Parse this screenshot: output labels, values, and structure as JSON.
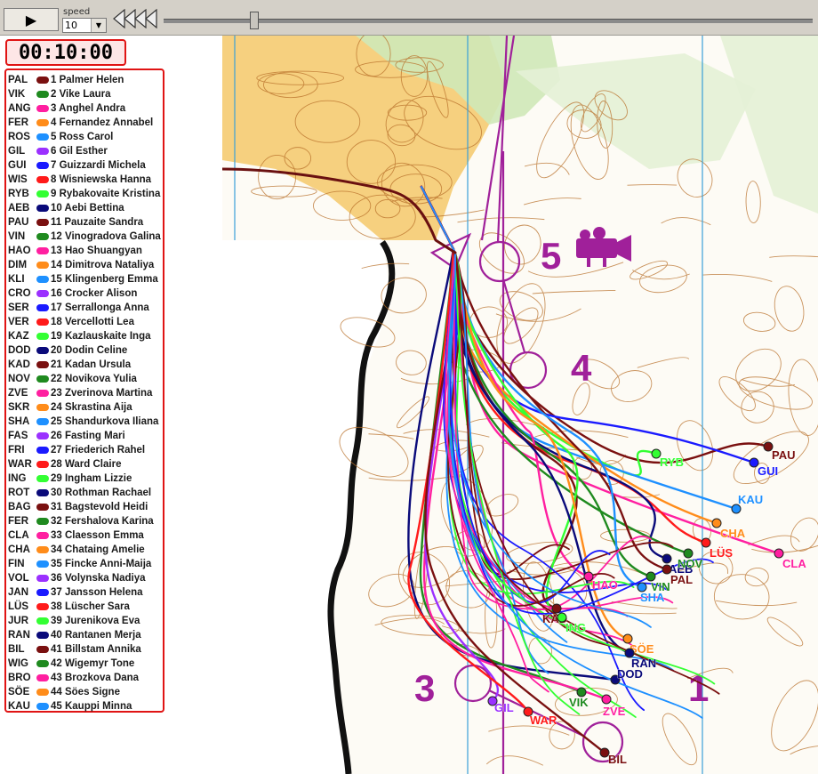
{
  "toolbar": {
    "play_icon": "play-icon",
    "play_symbol": "▶",
    "speed_label": "speed",
    "speed_value": "10",
    "rewind_icon": "rewind-icon",
    "timeline_position": 0.14
  },
  "clock": {
    "time": "00:10:00"
  },
  "runners": [
    {
      "code": "PAL",
      "name": "1 Palmer Helen",
      "color": "#7a1010"
    },
    {
      "code": "VIK",
      "name": "2 Vike Laura",
      "color": "#1f8a1f"
    },
    {
      "code": "ANG",
      "name": "3 Anghel Andra",
      "color": "#ff1fa0"
    },
    {
      "code": "FER",
      "name": "4 Fernandez Annabel",
      "color": "#ff8c1a"
    },
    {
      "code": "ROS",
      "name": "5 Ross Carol",
      "color": "#1e90ff"
    },
    {
      "code": "GIL",
      "name": "6 Gil Esther",
      "color": "#9b30ff"
    },
    {
      "code": "GUI",
      "name": "7 Guizzardi Michela",
      "color": "#1a1aff"
    },
    {
      "code": "WIS",
      "name": "8 Wisniewska Hanna",
      "color": "#ff1a1a"
    },
    {
      "code": "RYB",
      "name": "9 Rybakovaite Kristina",
      "color": "#33ff33"
    },
    {
      "code": "AEB",
      "name": "10 Aebi Bettina",
      "color": "#0a0a7a"
    },
    {
      "code": "PAU",
      "name": "11 Pauzaite Sandra",
      "color": "#7a1010"
    },
    {
      "code": "VIN",
      "name": "12 Vinogradova Galina",
      "color": "#1f8a1f"
    },
    {
      "code": "HAO",
      "name": "13 Hao Shuangyan",
      "color": "#ff1fa0"
    },
    {
      "code": "DIM",
      "name": "14 Dimitrova Nataliya",
      "color": "#ff8c1a"
    },
    {
      "code": "KLI",
      "name": "15 Klingenberg Emma",
      "color": "#1e90ff"
    },
    {
      "code": "CRO",
      "name": "16 Crocker Alison",
      "color": "#9b30ff"
    },
    {
      "code": "SER",
      "name": "17 Serrallonga Anna",
      "color": "#1a1aff"
    },
    {
      "code": "VER",
      "name": "18 Vercellotti Lea",
      "color": "#ff1a1a"
    },
    {
      "code": "KAZ",
      "name": "19 Kazlauskaite Inga",
      "color": "#33ff33"
    },
    {
      "code": "DOD",
      "name": "20 Dodin Celine",
      "color": "#0a0a7a"
    },
    {
      "code": "KAD",
      "name": "21 Kadan Ursula",
      "color": "#7a1010"
    },
    {
      "code": "NOV",
      "name": "22 Novikova Yulia",
      "color": "#1f8a1f"
    },
    {
      "code": "ZVE",
      "name": "23 Zverinova Martina",
      "color": "#ff1fa0"
    },
    {
      "code": "SKR",
      "name": "24 Skrastina Aija",
      "color": "#ff8c1a"
    },
    {
      "code": "SHA",
      "name": "25 Shandurkova Iliana",
      "color": "#1e90ff"
    },
    {
      "code": "FAS",
      "name": "26 Fasting Mari",
      "color": "#9b30ff"
    },
    {
      "code": "FRI",
      "name": "27 Friederich Rahel",
      "color": "#1a1aff"
    },
    {
      "code": "WAR",
      "name": "28 Ward Claire",
      "color": "#ff1a1a"
    },
    {
      "code": "ING",
      "name": "29 Ingham Lizzie",
      "color": "#33ff33"
    },
    {
      "code": "ROT",
      "name": "30 Rothman Rachael",
      "color": "#0a0a7a"
    },
    {
      "code": "BAG",
      "name": "31 Bagstevold Heidi",
      "color": "#7a1010"
    },
    {
      "code": "FER",
      "name": "32 Fershalova Karina",
      "color": "#1f8a1f"
    },
    {
      "code": "CLA",
      "name": "33 Claesson Emma",
      "color": "#ff1fa0"
    },
    {
      "code": "CHA",
      "name": "34 Chataing Amelie",
      "color": "#ff8c1a"
    },
    {
      "code": "FIN",
      "name": "35 Fincke Anni-Maija",
      "color": "#1e90ff"
    },
    {
      "code": "VOL",
      "name": "36 Volynska Nadiya",
      "color": "#9b30ff"
    },
    {
      "code": "JAN",
      "name": "37 Jansson Helena",
      "color": "#1a1aff"
    },
    {
      "code": "LÜS",
      "name": "38 Lüscher Sara",
      "color": "#ff1a1a"
    },
    {
      "code": "JUR",
      "name": "39 Jurenikova Eva",
      "color": "#33ff33"
    },
    {
      "code": "RAN",
      "name": "40 Rantanen Merja",
      "color": "#0a0a7a"
    },
    {
      "code": "BIL",
      "name": "41 Billstam Annika",
      "color": "#7a1010"
    },
    {
      "code": "WIG",
      "name": "42 Wigemyr Tone",
      "color": "#1f8a1f"
    },
    {
      "code": "BRO",
      "name": "43 Brozkova Dana",
      "color": "#ff1fa0"
    },
    {
      "code": "SÖE",
      "name": "44 Söes Signe",
      "color": "#ff8c1a"
    },
    {
      "code": "KAU",
      "name": "45 Kauppi Minna",
      "color": "#1e90ff"
    }
  ],
  "map": {
    "control_numbers": [
      "5",
      "4",
      "3",
      "1"
    ],
    "course_color": "#a0209a",
    "camera_icon": "camera-icon",
    "runner_markers": [
      {
        "label": "PAU",
        "color": "#7a1010"
      },
      {
        "label": "GUI",
        "color": "#1a1aff"
      },
      {
        "label": "RYB",
        "color": "#33ff33"
      },
      {
        "label": "KAU",
        "color": "#1e90ff"
      },
      {
        "label": "CHA",
        "color": "#ff8c1a"
      },
      {
        "label": "CLA",
        "color": "#ff1fa0"
      },
      {
        "label": "LÜS",
        "color": "#ff1a1a"
      },
      {
        "label": "AEB",
        "color": "#0a0a7a"
      },
      {
        "label": "NOV",
        "color": "#1f8a1f"
      },
      {
        "label": "PAL",
        "color": "#7a1010"
      },
      {
        "label": "VIN",
        "color": "#1f8a1f"
      },
      {
        "label": "SHA",
        "color": "#1e90ff"
      },
      {
        "label": "HAO",
        "color": "#ff1fa0"
      },
      {
        "label": "KAD",
        "color": "#7a1010"
      },
      {
        "label": "ING",
        "color": "#33ff33"
      },
      {
        "label": "SÖE",
        "color": "#ff8c1a"
      },
      {
        "label": "RAN",
        "color": "#0a0a7a"
      },
      {
        "label": "DOD",
        "color": "#0a0a7a"
      },
      {
        "label": "VIK",
        "color": "#1f8a1f"
      },
      {
        "label": "ZVE",
        "color": "#ff1fa0"
      },
      {
        "label": "GIL",
        "color": "#9b30ff"
      },
      {
        "label": "WAR",
        "color": "#ff1a1a"
      },
      {
        "label": "BIL",
        "color": "#7a1010"
      }
    ]
  }
}
